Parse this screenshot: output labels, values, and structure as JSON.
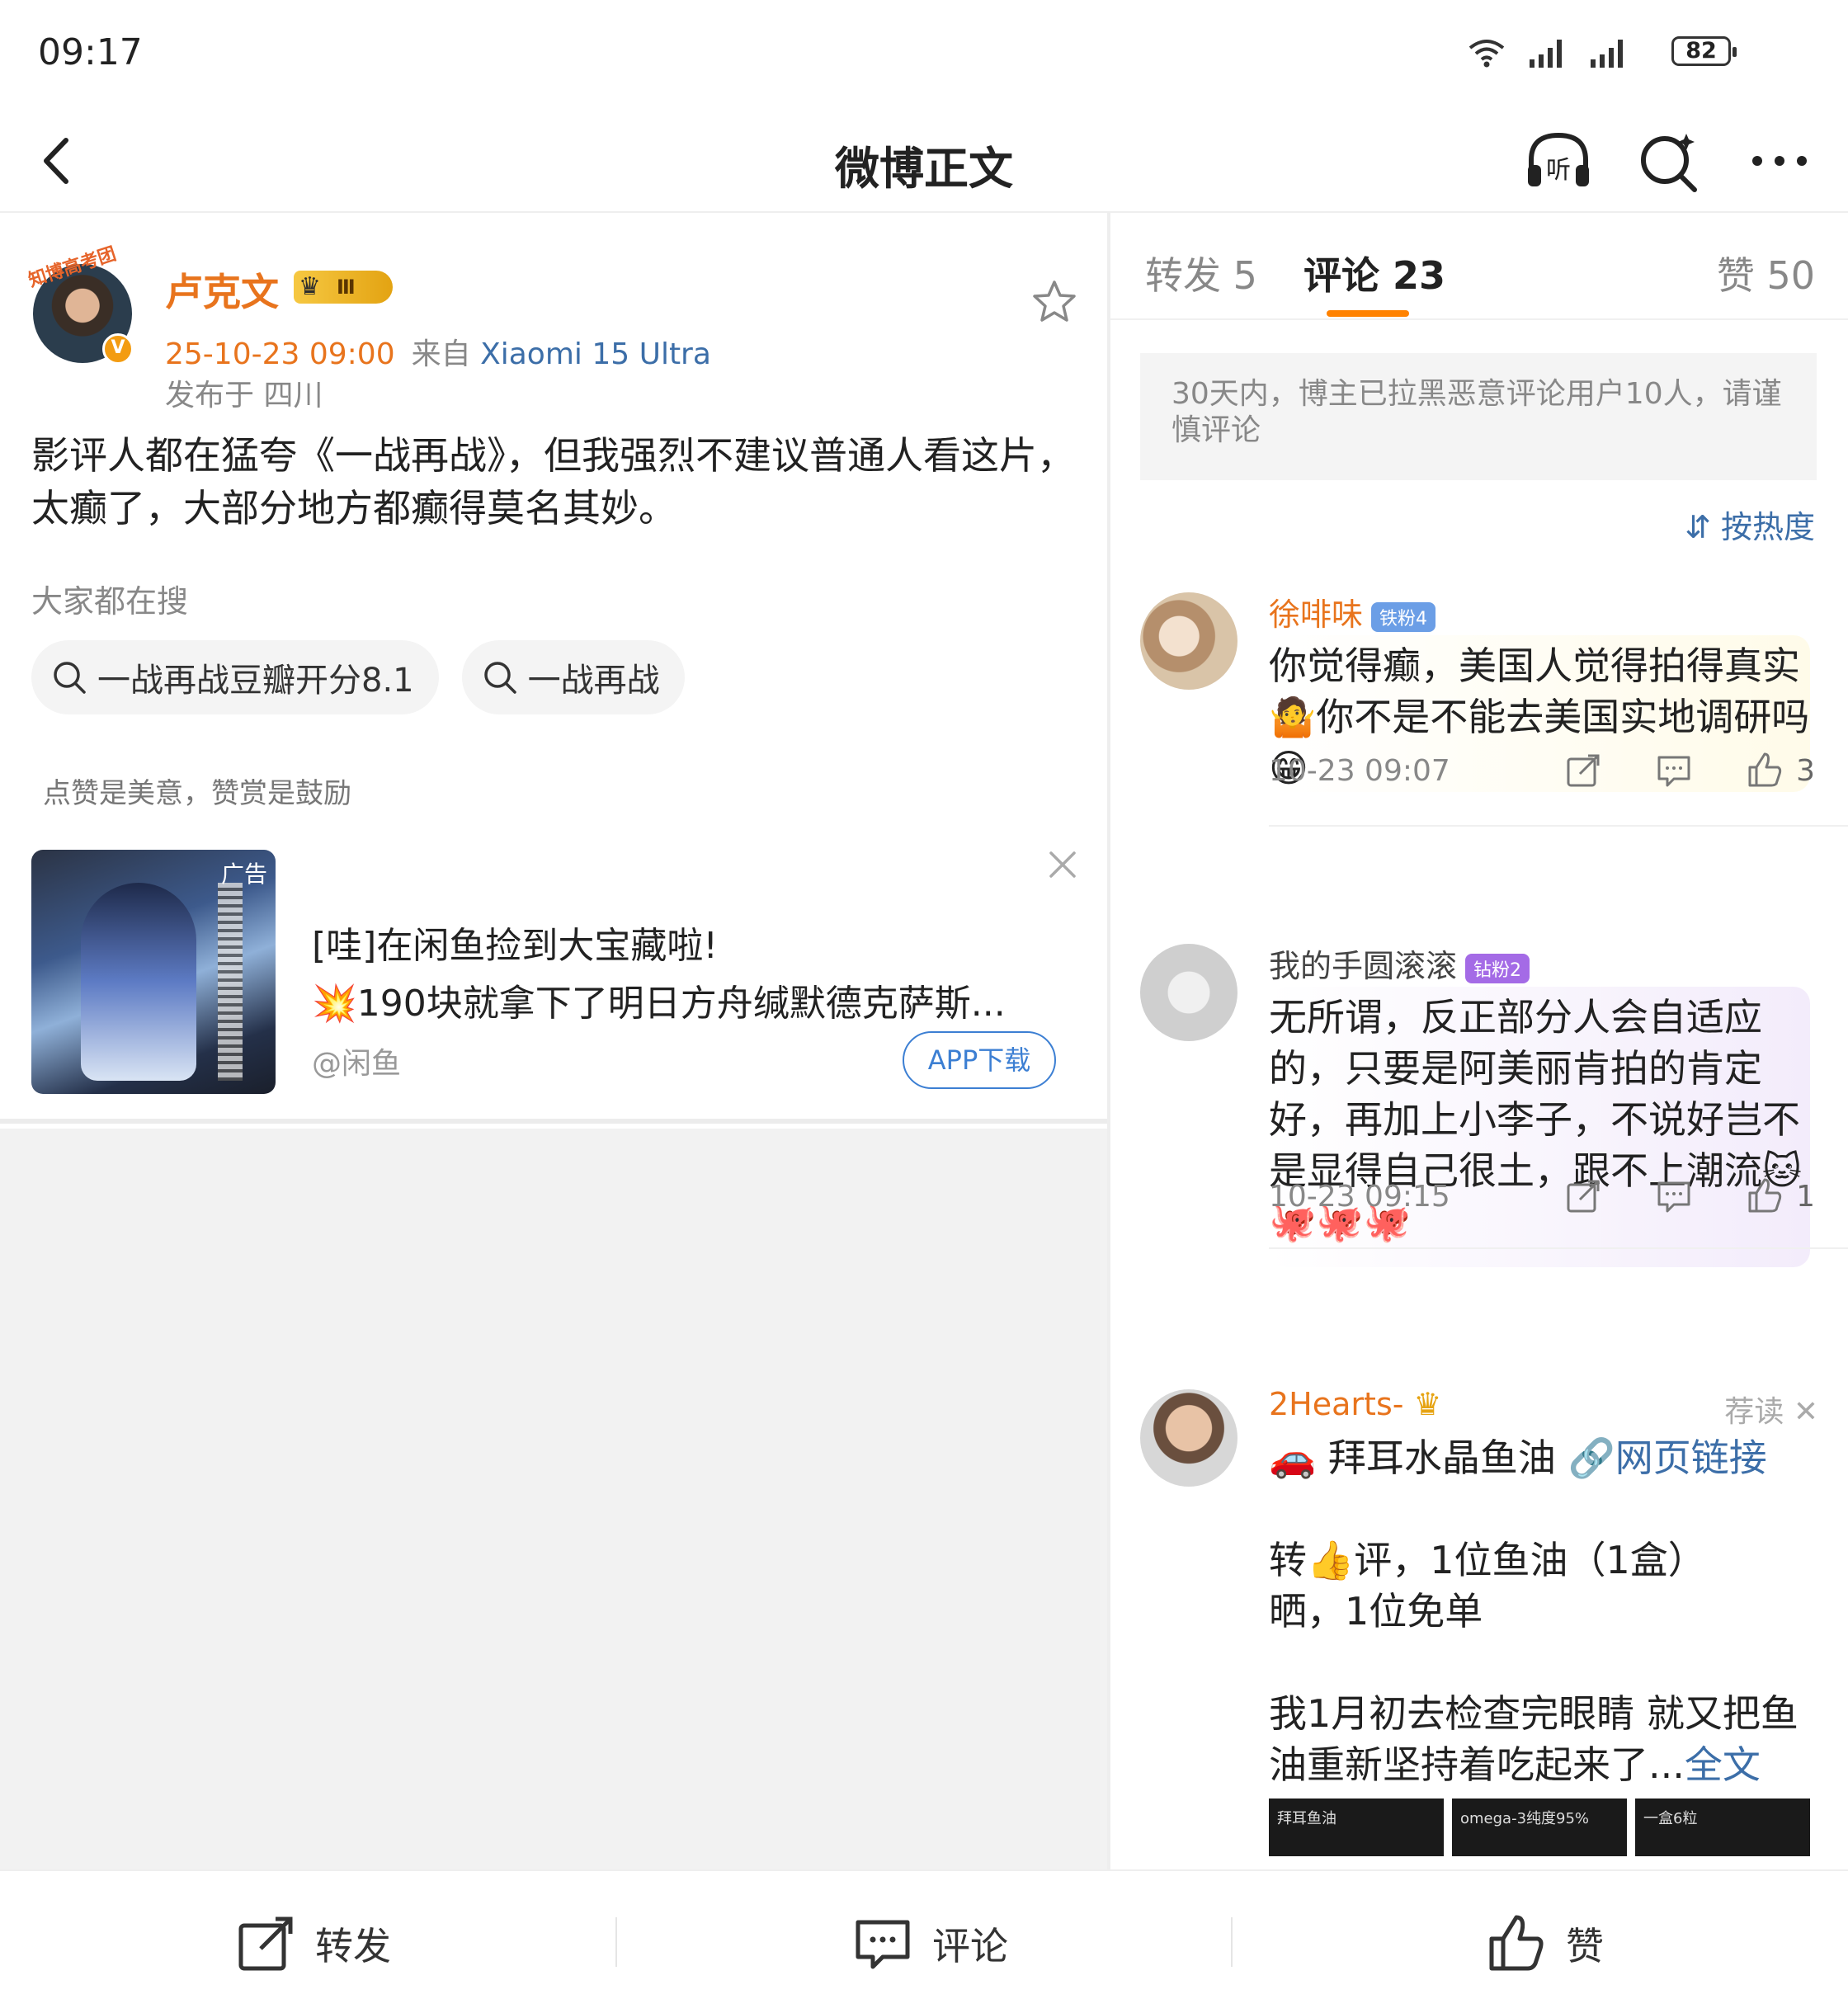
{
  "status": {
    "time": "09:17",
    "battery": "82"
  },
  "nav": {
    "title": "微博正文"
  },
  "post": {
    "author": "卢克文",
    "avatar_badge": "知博高考团",
    "vip_level": "Ⅲ",
    "date": "25-10-23 09:00",
    "source_prefix": "来自",
    "device": "Xiaomi 15 Ultra",
    "location": "发布于 四川",
    "text": "影评人都在猛夸《一战再战》，但我强烈不建议普通人看这片，太癫了，大部分地方都癫得莫名其妙。",
    "search_label": "大家都在搜",
    "search_chips": [
      "一战再战豆瓣开分8.1",
      "一战再战"
    ],
    "reward_hint": "点赞是美意，赞赏是鼓励"
  },
  "ad": {
    "tag": "广告",
    "title": "[哇]在闲鱼捡到大宝藏啦!",
    "desc": "💥190块就拿下了明日方舟缄默德克萨斯...",
    "source": "@闲鱼",
    "button": "APP下载"
  },
  "tabs": {
    "repost": "转发 5",
    "comment": "评论 23",
    "like": "赞 50"
  },
  "notice": "30天内，博主已拉黑恶意评论用户10人，请谨慎评论",
  "sort_label": "按热度",
  "comments": [
    {
      "name": "徐啡味",
      "badge": "铁粉4",
      "text": "你觉得癫，美国人觉得拍得真实🤷你不是不能去美国实地调研吗😁",
      "time": "10-23 09:07",
      "likes": "3"
    },
    {
      "name": "我的手圆滚滚",
      "badge": "钻粉2",
      "text": "无所谓，反正部分人会自适应的，只要是阿美丽肯拍的肯定好，再加上小李子，不说好岂不是显得自己很土，跟不上潮流🐱🐙🐙🐙",
      "time": "10-23 09:15",
      "likes": "1"
    },
    {
      "name": "2Hearts-",
      "ad_tag": "荐读",
      "line1_emoji": "🚗",
      "line1_text": "拜耳水晶鱼油",
      "line1_link": "🔗网页链接",
      "line2": "转👍评，1位鱼油（1盒）",
      "line3": "晒，1位免单",
      "line4": "我1月初去检查完眼睛 就又把鱼油重新坚持着吃起来了...",
      "more": "全文",
      "thumbs": [
        "拜耳鱼油",
        "omega-3纯度95%",
        "一盒6粒"
      ]
    }
  ],
  "bottom": {
    "repost": "转发",
    "comment": "评论",
    "like": "赞"
  }
}
